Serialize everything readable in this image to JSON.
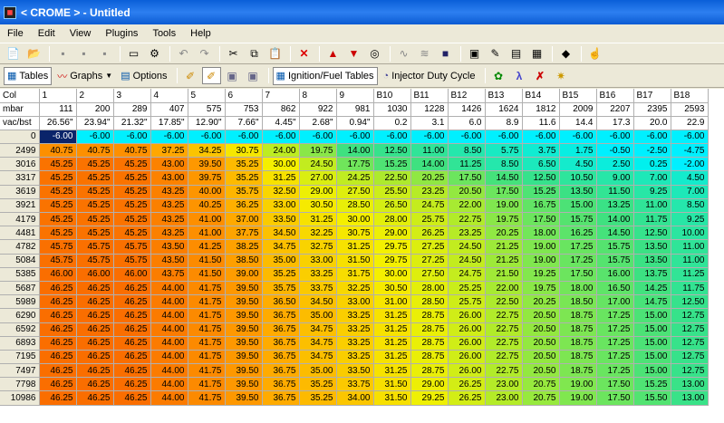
{
  "window": {
    "title": "< CROME > - Untitled"
  },
  "menu": [
    "File",
    "Edit",
    "View",
    "Plugins",
    "Tools",
    "Help"
  ],
  "toolbar2": {
    "tables": "Tables",
    "graphs": "Graphs",
    "options": "Options",
    "ignition": "Ignition/Fuel Tables",
    "injector": "Injector Duty Cycle"
  },
  "grid": {
    "col_label": "Col",
    "mbar_label": "mbar",
    "vac_label": "vac/bst",
    "columns": [
      "1",
      "2",
      "3",
      "4",
      "5",
      "6",
      "7",
      "8",
      "9",
      "B10",
      "B11",
      "B12",
      "B13",
      "B14",
      "B15",
      "B16",
      "B17",
      "B18"
    ],
    "mbar": [
      "111",
      "200",
      "289",
      "407",
      "575",
      "753",
      "862",
      "922",
      "981",
      "1030",
      "1228",
      "1426",
      "1624",
      "1812",
      "2009",
      "2207",
      "2395",
      "2593"
    ],
    "vac": [
      "26.56\"",
      "23.94\"",
      "21.32\"",
      "17.85\"",
      "12.90\"",
      "7.66\"",
      "4.45\"",
      "2.68\"",
      "0.94\"",
      "0.2",
      "3.1",
      "6.0",
      "8.9",
      "11.6",
      "14.4",
      "17.3",
      "20.0",
      "22.9"
    ],
    "rows": [
      {
        "rpm": "0",
        "v": [
          "-6.00",
          "-6.00",
          "-6.00",
          "-6.00",
          "-6.00",
          "-6.00",
          "-6.00",
          "-6.00",
          "-6.00",
          "-6.00",
          "-6.00",
          "-6.00",
          "-6.00",
          "-6.00",
          "-6.00",
          "-6.00",
          "-6.00",
          "-6.00"
        ]
      },
      {
        "rpm": "2499",
        "v": [
          "40.75",
          "40.75",
          "40.75",
          "37.25",
          "34.25",
          "30.75",
          "24.00",
          "19.75",
          "14.00",
          "12.50",
          "11.00",
          "8.50",
          "5.75",
          "3.75",
          "1.75",
          "-0.50",
          "-2.50",
          "-4.75"
        ]
      },
      {
        "rpm": "3016",
        "v": [
          "45.25",
          "45.25",
          "45.25",
          "43.00",
          "39.50",
          "35.25",
          "30.00",
          "24.50",
          "17.75",
          "15.25",
          "14.00",
          "11.25",
          "8.50",
          "6.50",
          "4.50",
          "2.50",
          "0.25",
          "-2.00"
        ]
      },
      {
        "rpm": "3317",
        "v": [
          "45.25",
          "45.25",
          "45.25",
          "43.00",
          "39.75",
          "35.25",
          "31.25",
          "27.00",
          "24.25",
          "22.50",
          "20.25",
          "17.50",
          "14.50",
          "12.50",
          "10.50",
          "9.00",
          "7.00",
          "4.50"
        ]
      },
      {
        "rpm": "3619",
        "v": [
          "45.25",
          "45.25",
          "45.25",
          "43.25",
          "40.00",
          "35.75",
          "32.50",
          "29.00",
          "27.50",
          "25.50",
          "23.25",
          "20.50",
          "17.50",
          "15.25",
          "13.50",
          "11.50",
          "9.25",
          "7.00"
        ]
      },
      {
        "rpm": "3921",
        "v": [
          "45.25",
          "45.25",
          "45.25",
          "43.25",
          "40.25",
          "36.25",
          "33.00",
          "30.50",
          "28.50",
          "26.50",
          "24.75",
          "22.00",
          "19.00",
          "16.75",
          "15.00",
          "13.25",
          "11.00",
          "8.50"
        ]
      },
      {
        "rpm": "4179",
        "v": [
          "45.25",
          "45.25",
          "45.25",
          "43.25",
          "41.00",
          "37.00",
          "33.50",
          "31.25",
          "30.00",
          "28.00",
          "25.75",
          "22.75",
          "19.75",
          "17.50",
          "15.75",
          "14.00",
          "11.75",
          "9.25"
        ]
      },
      {
        "rpm": "4481",
        "v": [
          "45.25",
          "45.25",
          "45.25",
          "43.25",
          "41.00",
          "37.75",
          "34.50",
          "32.25",
          "30.75",
          "29.00",
          "26.25",
          "23.25",
          "20.25",
          "18.00",
          "16.25",
          "14.50",
          "12.50",
          "10.00"
        ]
      },
      {
        "rpm": "4782",
        "v": [
          "45.75",
          "45.75",
          "45.75",
          "43.50",
          "41.25",
          "38.25",
          "34.75",
          "32.75",
          "31.25",
          "29.75",
          "27.25",
          "24.50",
          "21.25",
          "19.00",
          "17.25",
          "15.75",
          "13.50",
          "11.00"
        ]
      },
      {
        "rpm": "5084",
        "v": [
          "45.75",
          "45.75",
          "45.75",
          "43.50",
          "41.50",
          "38.50",
          "35.00",
          "33.00",
          "31.50",
          "29.75",
          "27.25",
          "24.50",
          "21.25",
          "19.00",
          "17.25",
          "15.75",
          "13.50",
          "11.00"
        ]
      },
      {
        "rpm": "5385",
        "v": [
          "46.00",
          "46.00",
          "46.00",
          "43.75",
          "41.50",
          "39.00",
          "35.25",
          "33.25",
          "31.75",
          "30.00",
          "27.50",
          "24.75",
          "21.50",
          "19.25",
          "17.50",
          "16.00",
          "13.75",
          "11.25"
        ]
      },
      {
        "rpm": "5687",
        "v": [
          "46.25",
          "46.25",
          "46.25",
          "44.00",
          "41.75",
          "39.50",
          "35.75",
          "33.75",
          "32.25",
          "30.50",
          "28.00",
          "25.25",
          "22.00",
          "19.75",
          "18.00",
          "16.50",
          "14.25",
          "11.75"
        ]
      },
      {
        "rpm": "5989",
        "v": [
          "46.25",
          "46.25",
          "46.25",
          "44.00",
          "41.75",
          "39.50",
          "36.50",
          "34.50",
          "33.00",
          "31.00",
          "28.50",
          "25.75",
          "22.50",
          "20.25",
          "18.50",
          "17.00",
          "14.75",
          "12.50"
        ]
      },
      {
        "rpm": "6290",
        "v": [
          "46.25",
          "46.25",
          "46.25",
          "44.00",
          "41.75",
          "39.50",
          "36.75",
          "35.00",
          "33.25",
          "31.25",
          "28.75",
          "26.00",
          "22.75",
          "20.50",
          "18.75",
          "17.25",
          "15.00",
          "12.75"
        ]
      },
      {
        "rpm": "6592",
        "v": [
          "46.25",
          "46.25",
          "46.25",
          "44.00",
          "41.75",
          "39.50",
          "36.75",
          "34.75",
          "33.25",
          "31.25",
          "28.75",
          "26.00",
          "22.75",
          "20.50",
          "18.75",
          "17.25",
          "15.00",
          "12.75"
        ]
      },
      {
        "rpm": "6893",
        "v": [
          "46.25",
          "46.25",
          "46.25",
          "44.00",
          "41.75",
          "39.50",
          "36.75",
          "34.75",
          "33.25",
          "31.25",
          "28.75",
          "26.00",
          "22.75",
          "20.50",
          "18.75",
          "17.25",
          "15.00",
          "12.75"
        ]
      },
      {
        "rpm": "7195",
        "v": [
          "46.25",
          "46.25",
          "46.25",
          "44.00",
          "41.75",
          "39.50",
          "36.75",
          "34.75",
          "33.25",
          "31.25",
          "28.75",
          "26.00",
          "22.75",
          "20.50",
          "18.75",
          "17.25",
          "15.00",
          "12.75"
        ]
      },
      {
        "rpm": "7497",
        "v": [
          "46.25",
          "46.25",
          "46.25",
          "44.00",
          "41.75",
          "39.50",
          "36.75",
          "35.00",
          "33.50",
          "31.25",
          "28.75",
          "26.00",
          "22.75",
          "20.50",
          "18.75",
          "17.25",
          "15.00",
          "12.75"
        ]
      },
      {
        "rpm": "7798",
        "v": [
          "46.25",
          "46.25",
          "46.25",
          "44.00",
          "41.75",
          "39.50",
          "36.75",
          "35.25",
          "33.75",
          "31.50",
          "29.00",
          "26.25",
          "23.00",
          "20.75",
          "19.00",
          "17.50",
          "15.25",
          "13.00"
        ]
      },
      {
        "rpm": "10986",
        "v": [
          "46.25",
          "46.25",
          "46.25",
          "44.00",
          "41.75",
          "39.50",
          "36.75",
          "35.25",
          "34.00",
          "31.50",
          "29.25",
          "26.25",
          "23.00",
          "20.75",
          "19.00",
          "17.50",
          "15.50",
          "13.00"
        ]
      }
    ]
  }
}
